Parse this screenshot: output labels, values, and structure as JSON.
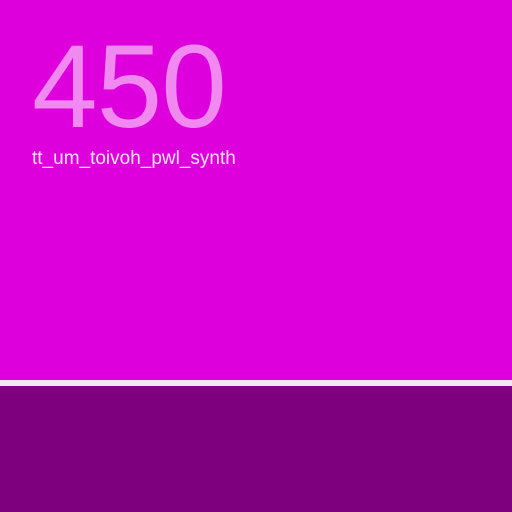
{
  "tile": {
    "number": "450",
    "title": "tt_um_toivoh_pwl_synth"
  },
  "colors": {
    "tile_background": "#dd00dd",
    "number_text": "#f08af0",
    "title_text": "#fbe3fb",
    "divider": "#f1e6f1",
    "bottom_band": "#7f007f"
  }
}
